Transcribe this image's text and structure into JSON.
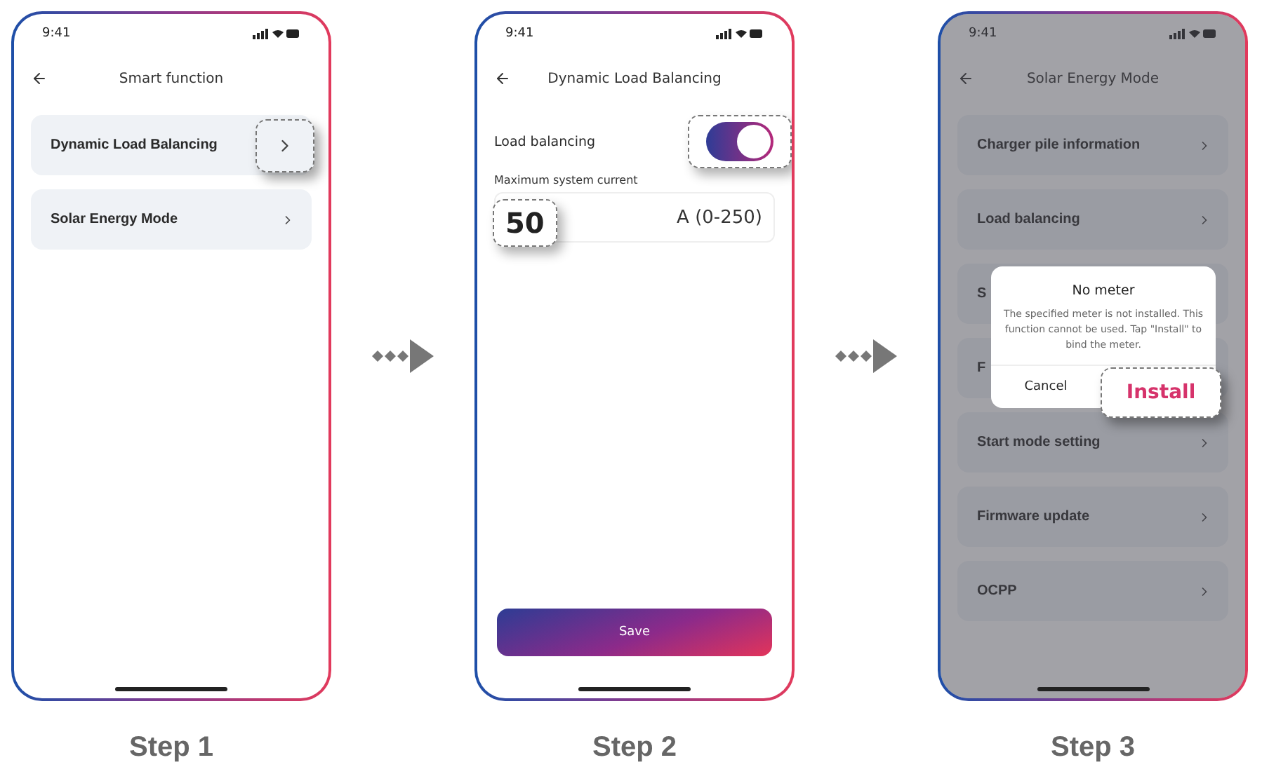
{
  "steps": [
    {
      "kind": "menu",
      "time": "9:41",
      "title": "Smart function",
      "items": [
        {
          "label": "Dynamic Load Balancing",
          "highlighted": true
        },
        {
          "label": "Solar Energy Mode",
          "highlighted": false
        }
      ],
      "caption": "Step 1"
    },
    {
      "kind": "form",
      "time": "9:41",
      "title": "Dynamic Load Balancing",
      "toggle": {
        "label": "Load balancing",
        "on": true
      },
      "field": {
        "label": "Maximum system current",
        "value": "50",
        "unit": "A (0-250)"
      },
      "save": "Save",
      "caption": "Step 2"
    },
    {
      "kind": "dialog",
      "time": "9:41",
      "title": "Solar Energy Mode",
      "items": [
        {
          "label": "Charger pile information"
        },
        {
          "label": "Load balancing"
        },
        {
          "label": "S"
        },
        {
          "label": "F"
        },
        {
          "label": "Start mode setting"
        },
        {
          "label": "Firmware update"
        },
        {
          "label": "OCPP"
        }
      ],
      "dialog": {
        "title": "No meter",
        "message": "The specified meter is not installed. This function cannot be used. Tap \"Install\" to bind the meter.",
        "cancel": "Cancel",
        "confirm": "Install"
      },
      "caption": "Step 3"
    }
  ]
}
